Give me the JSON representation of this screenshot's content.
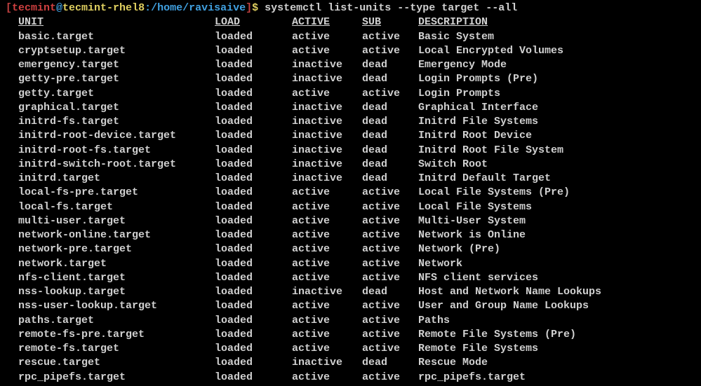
{
  "prompt": {
    "open_bracket": "[",
    "user": "tecmint",
    "at": "@",
    "host": "tecmint-rhel8",
    "colon": ":",
    "path": "/home/ravisaive",
    "close_bracket": "]",
    "dollar": "$",
    "command": "systemctl list-units --type target --all"
  },
  "headers": {
    "unit": "UNIT",
    "load": "LOAD",
    "active": "ACTIVE",
    "sub": "SUB",
    "description": "DESCRIPTION"
  },
  "rows": [
    {
      "unit": "basic.target",
      "load": "loaded",
      "active": "active",
      "sub": "active",
      "desc": "Basic System"
    },
    {
      "unit": "cryptsetup.target",
      "load": "loaded",
      "active": "active",
      "sub": "active",
      "desc": "Local Encrypted Volumes"
    },
    {
      "unit": "emergency.target",
      "load": "loaded",
      "active": "inactive",
      "sub": "dead",
      "desc": "Emergency Mode"
    },
    {
      "unit": "getty-pre.target",
      "load": "loaded",
      "active": "inactive",
      "sub": "dead",
      "desc": "Login Prompts (Pre)"
    },
    {
      "unit": "getty.target",
      "load": "loaded",
      "active": "active",
      "sub": "active",
      "desc": "Login Prompts"
    },
    {
      "unit": "graphical.target",
      "load": "loaded",
      "active": "inactive",
      "sub": "dead",
      "desc": "Graphical Interface"
    },
    {
      "unit": "initrd-fs.target",
      "load": "loaded",
      "active": "inactive",
      "sub": "dead",
      "desc": "Initrd File Systems"
    },
    {
      "unit": "initrd-root-device.target",
      "load": "loaded",
      "active": "inactive",
      "sub": "dead",
      "desc": "Initrd Root Device"
    },
    {
      "unit": "initrd-root-fs.target",
      "load": "loaded",
      "active": "inactive",
      "sub": "dead",
      "desc": "Initrd Root File System"
    },
    {
      "unit": "initrd-switch-root.target",
      "load": "loaded",
      "active": "inactive",
      "sub": "dead",
      "desc": "Switch Root"
    },
    {
      "unit": "initrd.target",
      "load": "loaded",
      "active": "inactive",
      "sub": "dead",
      "desc": "Initrd Default Target"
    },
    {
      "unit": "local-fs-pre.target",
      "load": "loaded",
      "active": "active",
      "sub": "active",
      "desc": "Local File Systems (Pre)"
    },
    {
      "unit": "local-fs.target",
      "load": "loaded",
      "active": "active",
      "sub": "active",
      "desc": "Local File Systems"
    },
    {
      "unit": "multi-user.target",
      "load": "loaded",
      "active": "active",
      "sub": "active",
      "desc": "Multi-User System"
    },
    {
      "unit": "network-online.target",
      "load": "loaded",
      "active": "active",
      "sub": "active",
      "desc": "Network is Online"
    },
    {
      "unit": "network-pre.target",
      "load": "loaded",
      "active": "active",
      "sub": "active",
      "desc": "Network (Pre)"
    },
    {
      "unit": "network.target",
      "load": "loaded",
      "active": "active",
      "sub": "active",
      "desc": "Network"
    },
    {
      "unit": "nfs-client.target",
      "load": "loaded",
      "active": "active",
      "sub": "active",
      "desc": "NFS client services"
    },
    {
      "unit": "nss-lookup.target",
      "load": "loaded",
      "active": "inactive",
      "sub": "dead",
      "desc": "Host and Network Name Lookups"
    },
    {
      "unit": "nss-user-lookup.target",
      "load": "loaded",
      "active": "active",
      "sub": "active",
      "desc": "User and Group Name Lookups"
    },
    {
      "unit": "paths.target",
      "load": "loaded",
      "active": "active",
      "sub": "active",
      "desc": "Paths"
    },
    {
      "unit": "remote-fs-pre.target",
      "load": "loaded",
      "active": "active",
      "sub": "active",
      "desc": "Remote File Systems (Pre)"
    },
    {
      "unit": "remote-fs.target",
      "load": "loaded",
      "active": "active",
      "sub": "active",
      "desc": "Remote File Systems"
    },
    {
      "unit": "rescue.target",
      "load": "loaded",
      "active": "inactive",
      "sub": "dead",
      "desc": "Rescue Mode"
    },
    {
      "unit": "rpc_pipefs.target",
      "load": "loaded",
      "active": "active",
      "sub": "active",
      "desc": "rpc_pipefs.target"
    }
  ]
}
